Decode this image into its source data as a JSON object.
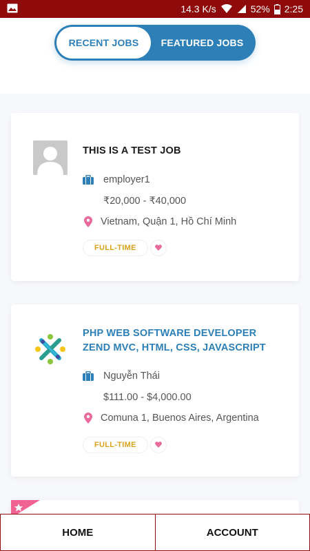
{
  "status_bar": {
    "speed": "14.3 K/s",
    "battery": "52%",
    "time": "2:25",
    "icons": [
      "image-icon",
      "wifi-icon",
      "signal-icon",
      "battery-icon"
    ]
  },
  "tabs": [
    {
      "label": "RECENT JOBS",
      "active": true
    },
    {
      "label": "FEATURED JOBS",
      "active": false
    }
  ],
  "jobs": [
    {
      "title": "THIS IS A TEST JOB",
      "employer": "employer1",
      "salary": "₹20,000 - ₹40,000",
      "location": "Vietnam, Quận 1, Hồ Chí Minh",
      "type": "FULL-TIME",
      "logo": "avatar-placeholder-icon"
    },
    {
      "title": "PHP WEB SOFTWARE DEVELOPER ZEND MVC, HTML, CSS, JAVASCRIPT",
      "employer": "Nguyễn Thái",
      "salary": "$111.00 - $4,000.00",
      "location": "Comuna 1, Buenos Aires, Argentina",
      "type": "FULL-TIME",
      "logo": "company-logo-icon"
    }
  ],
  "bottom_nav": {
    "home": "HOME",
    "account": "ACCOUNT"
  },
  "colors": {
    "status_bar": "#8f0a0a",
    "primary": "#2d7fb8",
    "badge_text": "#d9a21b",
    "heart": "#e86b9b",
    "location_pin": "#e86b9b"
  }
}
